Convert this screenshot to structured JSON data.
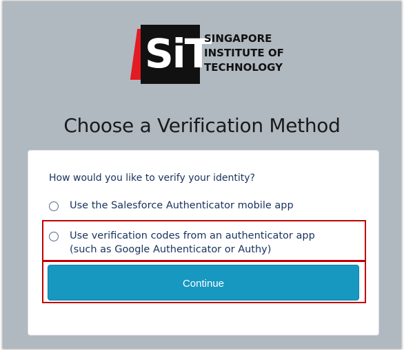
{
  "logo": {
    "mark": "SiT",
    "lines": [
      "SINGAPORE",
      "INSTITUTE OF",
      "TECHNOLOGY"
    ],
    "colors": {
      "red": "#e31b23",
      "black": "#111111"
    }
  },
  "page": {
    "title": "Choose a Verification Method"
  },
  "form": {
    "question": "How would you like to verify your identity?",
    "options": [
      {
        "label": "Use the Salesforce Authenticator mobile app",
        "selected": false
      },
      {
        "label_line1": "Use verification codes from an authenticator app",
        "label_line2": "(such as Google Authenticator or Authy)",
        "selected": false
      }
    ],
    "continue_label": "Continue",
    "button_color": "#1798c1"
  }
}
